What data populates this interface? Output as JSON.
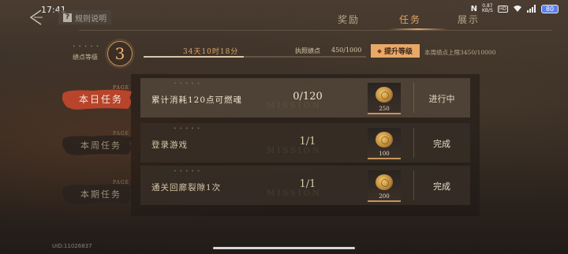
{
  "status_bar": {
    "time": "17:41",
    "net_speed": "0.87\nKB/S",
    "battery": "80"
  },
  "header": {
    "rules_label": "规则说明",
    "tabs": [
      {
        "label": "奖励",
        "active": false
      },
      {
        "label": "任务",
        "active": true
      },
      {
        "label": "展示",
        "active": false
      }
    ]
  },
  "level": {
    "label": "绩点等级",
    "value": "3",
    "time_left": "34天10时18分",
    "merit_label": "执照绩点",
    "merit_value": "450/1000",
    "merit_progress": 0.45,
    "upgrade_label": "提升等级",
    "weekly_cap": "本周绩点上限3450/10000"
  },
  "categories": [
    {
      "label": "本日任务",
      "page_tag": "PAGE",
      "active": true
    },
    {
      "label": "本周任务",
      "page_tag": "PAGE",
      "active": false
    },
    {
      "label": "本期任务",
      "page_tag": "PAGE",
      "active": false
    }
  ],
  "tasks": [
    {
      "desc": "累计消耗120点可燃魂",
      "progress": "0/120",
      "reward_amount": "250",
      "status": "进行中",
      "watermark": "MISSION"
    },
    {
      "desc": "登录游戏",
      "progress": "1/1",
      "reward_amount": "100",
      "status": "完成",
      "watermark": "MISSION"
    },
    {
      "desc": "通关回廊裂隙1次",
      "progress": "1/1",
      "reward_amount": "200",
      "status": "完成",
      "watermark": "MISSION"
    }
  ],
  "footer": {
    "uid": "UID:11026837"
  },
  "colors": {
    "accent": "#e0a468",
    "upgrade_button": "#e8a868",
    "active_tab_brush": "#b8442c"
  }
}
